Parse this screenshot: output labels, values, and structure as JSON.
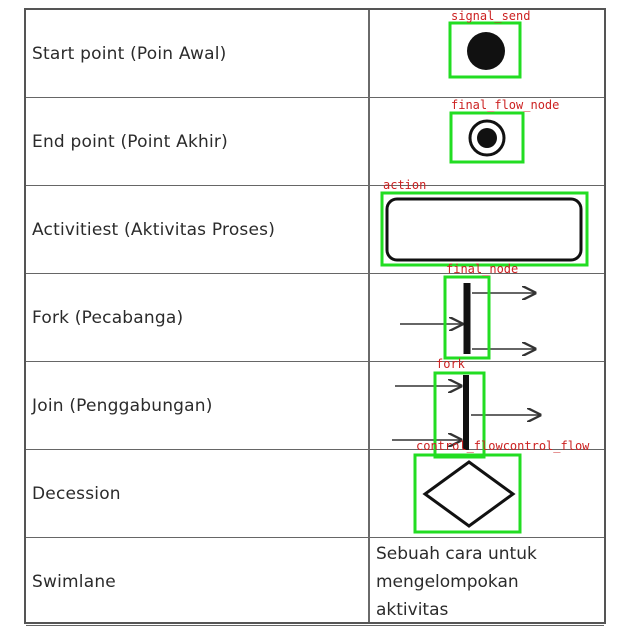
{
  "rows": [
    {
      "label": "Start point (Poin Awal)"
    },
    {
      "label": "End point (Point Akhir)"
    },
    {
      "label": "Activitiest (Aktivitas Proses)"
    },
    {
      "label": "Fork (Pecabanga)"
    },
    {
      "label": "Join (Penggabungan)"
    },
    {
      "label": "Decession"
    },
    {
      "label": "Swimlane",
      "desc": [
        "Sebuah cara untuk",
        "mengelompokan",
        "aktivitas"
      ]
    }
  ],
  "detections": [
    {
      "label": "signal_send"
    },
    {
      "label": "final_flow_node"
    },
    {
      "label": "action"
    },
    {
      "label": "final_node"
    },
    {
      "label": "fork"
    },
    {
      "label": "control_flowcontrol_flow"
    }
  ],
  "colors": {
    "box": "#22dd22",
    "label": "#cc2222"
  }
}
